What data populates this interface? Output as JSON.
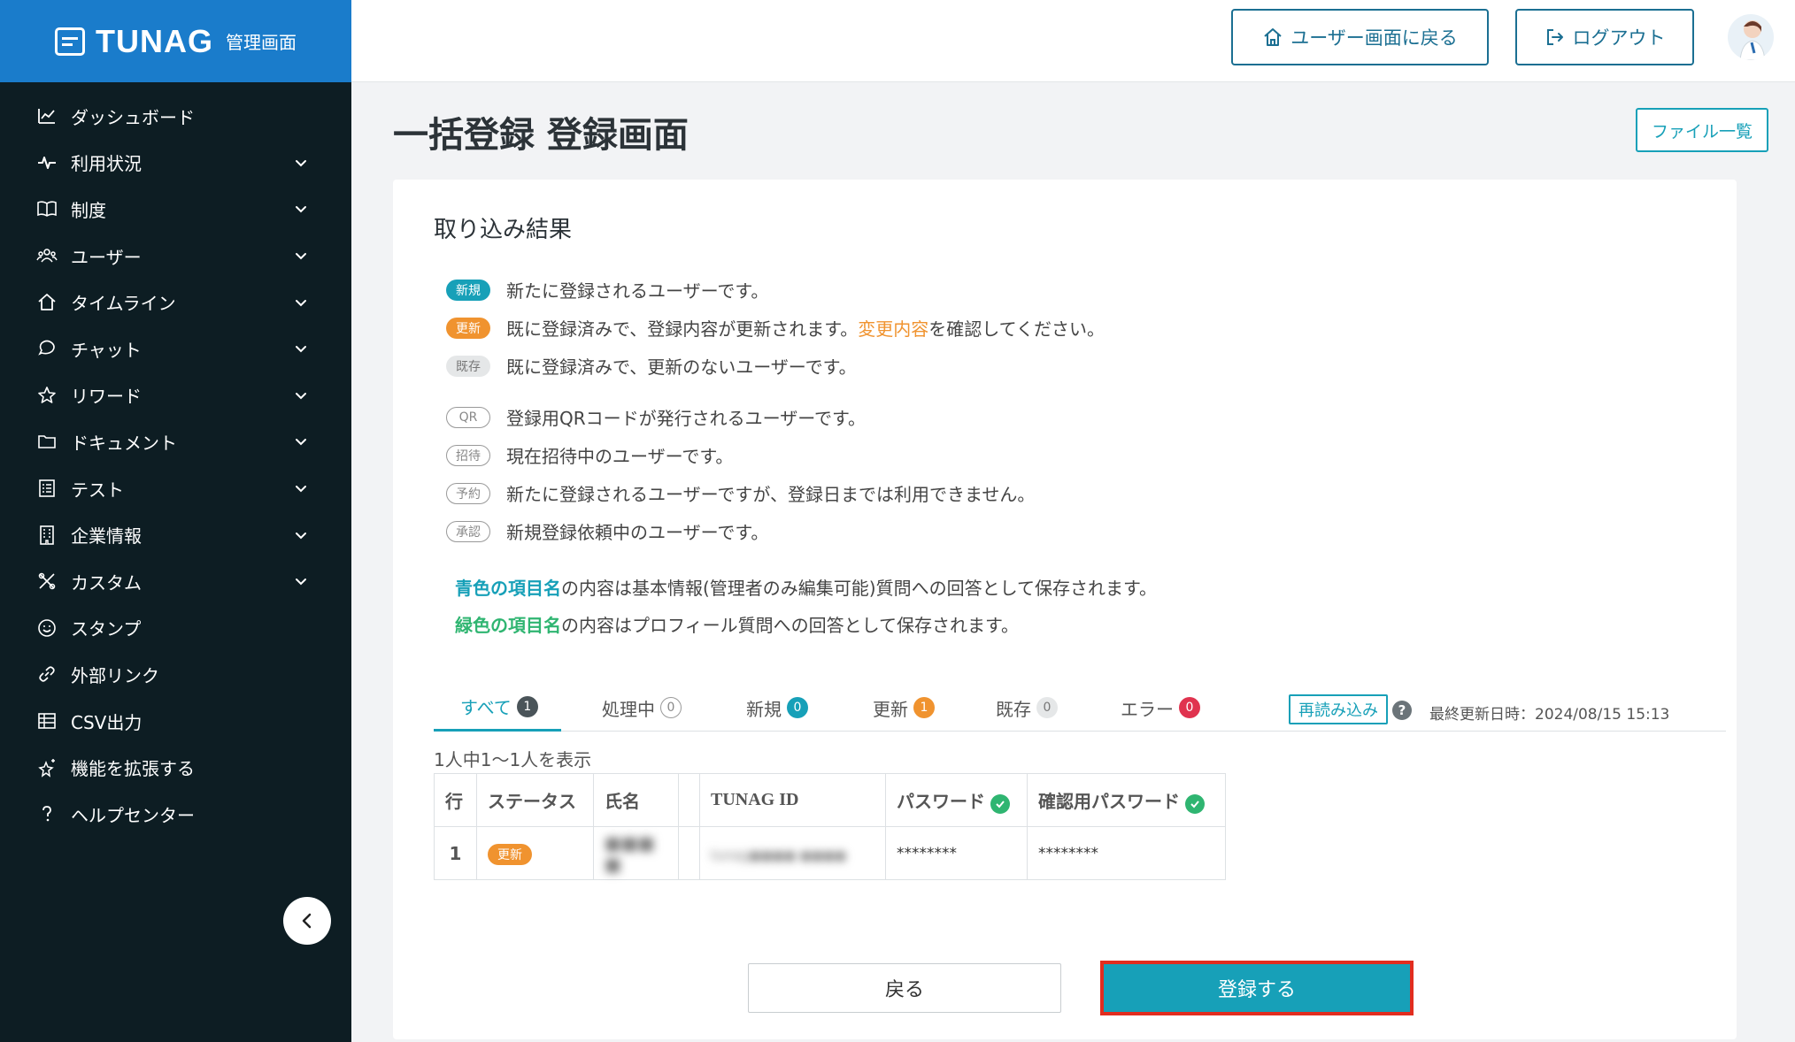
{
  "brand": {
    "name": "TUNAG",
    "sub": "管理画面"
  },
  "sidebar": {
    "items": [
      {
        "label": "ダッシュボード",
        "icon": "chart-icon",
        "expandable": false
      },
      {
        "label": "利用状況",
        "icon": "pulse-icon",
        "expandable": true
      },
      {
        "label": "制度",
        "icon": "book-icon",
        "expandable": true
      },
      {
        "label": "ユーザー",
        "icon": "users-icon",
        "expandable": true
      },
      {
        "label": "タイムライン",
        "icon": "home-icon",
        "expandable": true
      },
      {
        "label": "チャット",
        "icon": "chat-icon",
        "expandable": true
      },
      {
        "label": "リワード",
        "icon": "star-icon",
        "expandable": true
      },
      {
        "label": "ドキュメント",
        "icon": "folder-icon",
        "expandable": true
      },
      {
        "label": "テスト",
        "icon": "checklist-icon",
        "expandable": true
      },
      {
        "label": "企業情報",
        "icon": "building-icon",
        "expandable": true
      },
      {
        "label": "カスタム",
        "icon": "tools-icon",
        "expandable": true
      },
      {
        "label": "スタンプ",
        "icon": "smile-icon",
        "expandable": false
      },
      {
        "label": "外部リンク",
        "icon": "link-icon",
        "expandable": false
      },
      {
        "label": "CSV出力",
        "icon": "table-icon",
        "expandable": false
      },
      {
        "label": "機能を拡張する",
        "icon": "sparkle-star-icon",
        "expandable": false
      },
      {
        "label": "ヘルプセンター",
        "icon": "question-icon",
        "expandable": false
      }
    ]
  },
  "header": {
    "user_screen_label": "ユーザー画面に戻る",
    "logout_label": "ログアウト"
  },
  "page": {
    "title": "一括登録 登録画面",
    "files_label": "ファイル一覧"
  },
  "result": {
    "title": "取り込み結果",
    "legend": [
      {
        "badge": "新規",
        "text": "新たに登録されるユーザーです。",
        "color": "#17a0b8"
      },
      {
        "badge": "更新",
        "text_before": "既に登録済みで、登録内容が更新されます。",
        "link": "変更内容",
        "text_after": "を確認してください。",
        "color": "#f0932f"
      },
      {
        "badge": "既存",
        "text": "既に登録済みで、更新のないユーザーです。",
        "color": "#e5e7e8"
      }
    ],
    "legend2": [
      {
        "badge": "QR",
        "text": "登録用QRコードが発行されるユーザーです。"
      },
      {
        "badge": "招待",
        "text": "現在招待中のユーザーです。"
      },
      {
        "badge": "予約",
        "text": "新たに登録されるユーザーですが、登録日までは利用できません。"
      },
      {
        "badge": "承認",
        "text": "新規登録依頼中のユーザーです。"
      }
    ],
    "note_blue_bold": "青色の項目名",
    "note_blue_rest": "の内容は基本情報(管理者のみ編集可能)質問への回答として保存されます。",
    "note_green_bold": "緑色の項目名",
    "note_green_rest": "の内容はプロフィール質問への回答として保存されます。"
  },
  "tabs": [
    {
      "label": "すべて",
      "count": "1",
      "color": "#4a5459"
    },
    {
      "label": "処理中",
      "count": "0",
      "color": "outline"
    },
    {
      "label": "新規",
      "count": "0",
      "color": "#17a0b8"
    },
    {
      "label": "更新",
      "count": "1",
      "color": "#f0932f"
    },
    {
      "label": "既存",
      "count": "0",
      "color": "#e5e7e8"
    },
    {
      "label": "エラー",
      "count": "0",
      "color": "#e0334f"
    }
  ],
  "reload_label": "再読み込み",
  "last_updated": "最終更新日時：2024/08/15 15:13",
  "row_count": "1人中1〜1人を表示",
  "table": {
    "headers": [
      "行",
      "ステータス",
      "氏名",
      "",
      "TUNAG ID",
      "パスワード",
      "確認用パスワード"
    ],
    "rows": [
      {
        "row": "1",
        "status": "更新",
        "name": "■■■ ■",
        "id": "tunag●●●● ●●●●",
        "password": "********",
        "password_confirm": "********"
      }
    ]
  },
  "actions": {
    "back_label": "戻る",
    "submit_label": "登録する"
  }
}
